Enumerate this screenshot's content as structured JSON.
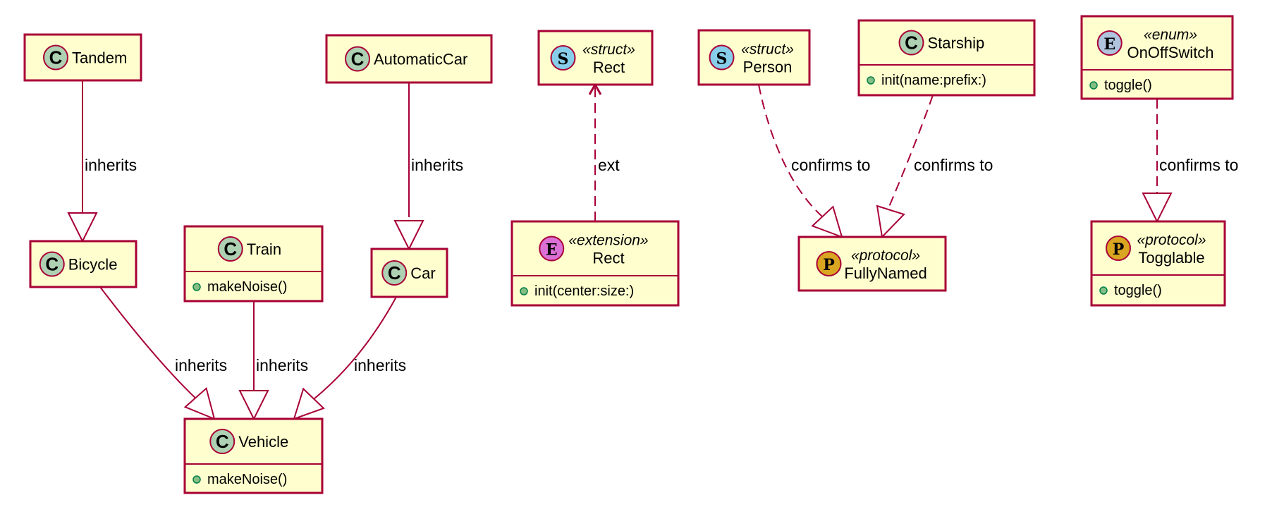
{
  "diagram": {
    "type": "uml-class-diagram",
    "colors": {
      "border": "#A80036",
      "node_fill": "#FEFECE",
      "class_badge": "#ADD1B2",
      "struct_badge": "#87CEEB",
      "extension_badge": "#DA70D6",
      "protocol_badge": "#DAA520",
      "enum_badge": "#B0C4DE",
      "method_dot": "#84BE84"
    },
    "nodes": [
      {
        "id": "tandem",
        "kind": "class",
        "badge": "C",
        "stereotype": "",
        "name": "Tandem",
        "members": []
      },
      {
        "id": "bicycle",
        "kind": "class",
        "badge": "C",
        "stereotype": "",
        "name": "Bicycle",
        "members": []
      },
      {
        "id": "train",
        "kind": "class",
        "badge": "C",
        "stereotype": "",
        "name": "Train",
        "members": [
          "makeNoise()"
        ]
      },
      {
        "id": "automaticcar",
        "kind": "class",
        "badge": "C",
        "stereotype": "",
        "name": "AutomaticCar",
        "members": []
      },
      {
        "id": "car",
        "kind": "class",
        "badge": "C",
        "stereotype": "",
        "name": "Car",
        "members": []
      },
      {
        "id": "vehicle",
        "kind": "class",
        "badge": "C",
        "stereotype": "",
        "name": "Vehicle",
        "members": [
          "makeNoise()"
        ]
      },
      {
        "id": "rect-struct",
        "kind": "struct",
        "badge": "S",
        "stereotype": "«struct»",
        "name": "Rect",
        "members": []
      },
      {
        "id": "rect-extension",
        "kind": "extension",
        "badge": "E",
        "stereotype": "«extension»",
        "name": "Rect",
        "members": [
          "init(center:size:)"
        ]
      },
      {
        "id": "person",
        "kind": "struct",
        "badge": "S",
        "stereotype": "«struct»",
        "name": "Person",
        "members": []
      },
      {
        "id": "starship",
        "kind": "class",
        "badge": "C",
        "stereotype": "",
        "name": "Starship",
        "members": [
          "init(name:prefix:)"
        ]
      },
      {
        "id": "fullynamed",
        "kind": "protocol",
        "badge": "P",
        "stereotype": "«protocol»",
        "name": "FullyNamed",
        "members": []
      },
      {
        "id": "onoffswitch",
        "kind": "enum",
        "badge": "E",
        "stereotype": "«enum»",
        "name": "OnOffSwitch",
        "members": [
          "toggle()"
        ]
      },
      {
        "id": "togglable",
        "kind": "protocol",
        "badge": "P",
        "stereotype": "«protocol»",
        "name": "Togglable",
        "members": [
          "toggle()"
        ]
      }
    ],
    "edges": [
      {
        "from": "tandem",
        "to": "bicycle",
        "style": "solid",
        "arrow": "hollow-triangle",
        "label": "inherits"
      },
      {
        "from": "automaticcar",
        "to": "car",
        "style": "solid",
        "arrow": "hollow-triangle",
        "label": "inherits"
      },
      {
        "from": "bicycle",
        "to": "vehicle",
        "style": "solid",
        "arrow": "hollow-triangle",
        "label": "inherits"
      },
      {
        "from": "train",
        "to": "vehicle",
        "style": "solid",
        "arrow": "hollow-triangle",
        "label": "inherits"
      },
      {
        "from": "car",
        "to": "vehicle",
        "style": "solid",
        "arrow": "hollow-triangle",
        "label": "inherits"
      },
      {
        "from": "rect-extension",
        "to": "rect-struct",
        "style": "dashed",
        "arrow": "open",
        "label": "ext"
      },
      {
        "from": "person",
        "to": "fullynamed",
        "style": "dashed",
        "arrow": "hollow-triangle",
        "label": "confirms to"
      },
      {
        "from": "starship",
        "to": "fullynamed",
        "style": "dashed",
        "arrow": "hollow-triangle",
        "label": "confirms to"
      },
      {
        "from": "onoffswitch",
        "to": "togglable",
        "style": "dashed",
        "arrow": "hollow-triangle",
        "label": "confirms to"
      }
    ]
  }
}
